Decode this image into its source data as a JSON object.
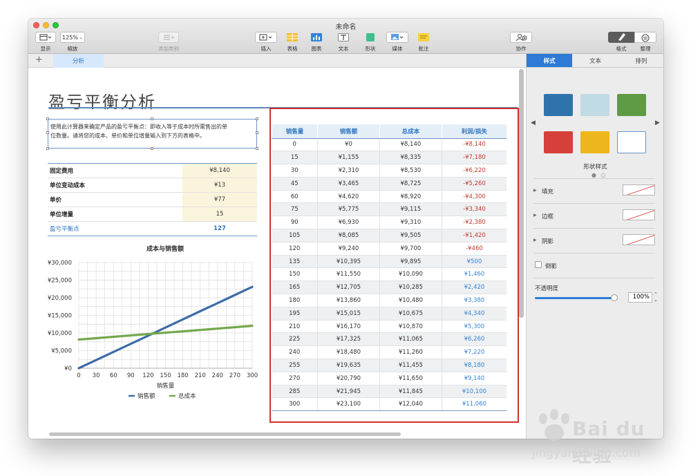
{
  "window": {
    "title": "未命名"
  },
  "toolbar": {
    "view_label": "显示",
    "zoom_value": "125%",
    "zoom_label": "缩放",
    "add_category_label": "添加类别",
    "insert_label": "插入",
    "table_label": "表格",
    "chart_label": "图表",
    "text_label": "文本",
    "shape_label": "形状",
    "media_label": "媒体",
    "comment_label": "批注",
    "collaborate_label": "协作",
    "format_label": "格式",
    "organize_label": "整理"
  },
  "sheet": {
    "add_symbol": "+",
    "tab_label": "分析"
  },
  "doc": {
    "title": "盈亏平衡分析",
    "intro_line1": "使用此计算器来确定产品的盈亏平衡点：即收入等于成本时所需售出的单",
    "intro_line2": "位数量。请将您的成本、单价和单位增量输入到下方的表格中。"
  },
  "inputs": [
    {
      "label": "固定费用",
      "value": "¥8,140"
    },
    {
      "label": "单位变动成本",
      "value": "¥13"
    },
    {
      "label": "单价",
      "value": "¥77"
    },
    {
      "label": "单位增量",
      "value": "15"
    },
    {
      "label": "盈亏平衡点",
      "value": "127"
    }
  ],
  "data_table": {
    "headers": [
      "销售量",
      "销售额",
      "总成本",
      "利润/损失"
    ],
    "rows": [
      [
        "0",
        "¥0",
        "¥8,140",
        "-¥8,140"
      ],
      [
        "15",
        "¥1,155",
        "¥8,335",
        "-¥7,180"
      ],
      [
        "30",
        "¥2,310",
        "¥8,530",
        "-¥6,220"
      ],
      [
        "45",
        "¥3,465",
        "¥8,725",
        "-¥5,260"
      ],
      [
        "60",
        "¥4,620",
        "¥8,920",
        "-¥4,300"
      ],
      [
        "75",
        "¥5,775",
        "¥9,115",
        "-¥3,340"
      ],
      [
        "90",
        "¥6,930",
        "¥9,310",
        "-¥2,380"
      ],
      [
        "105",
        "¥8,085",
        "¥9,505",
        "-¥1,420"
      ],
      [
        "120",
        "¥9,240",
        "¥9,700",
        "-¥460"
      ],
      [
        "135",
        "¥10,395",
        "¥9,895",
        "¥500"
      ],
      [
        "150",
        "¥11,550",
        "¥10,090",
        "¥1,460"
      ],
      [
        "165",
        "¥12,705",
        "¥10,285",
        "¥2,420"
      ],
      [
        "180",
        "¥13,860",
        "¥10,480",
        "¥3,380"
      ],
      [
        "195",
        "¥15,015",
        "¥10,675",
        "¥4,340"
      ],
      [
        "210",
        "¥16,170",
        "¥10,870",
        "¥5,300"
      ],
      [
        "225",
        "¥17,325",
        "¥11,065",
        "¥6,260"
      ],
      [
        "240",
        "¥18,480",
        "¥11,260",
        "¥7,220"
      ],
      [
        "255",
        "¥19,635",
        "¥11,455",
        "¥8,180"
      ],
      [
        "270",
        "¥20,790",
        "¥11,650",
        "¥9,140"
      ],
      [
        "285",
        "¥21,945",
        "¥11,845",
        "¥10,100"
      ],
      [
        "300",
        "¥23,100",
        "¥12,040",
        "¥11,060"
      ]
    ]
  },
  "chart_data": {
    "type": "line",
    "title": "成本与销售额",
    "xlabel": "销售量",
    "ylabel": "",
    "x": [
      0,
      30,
      60,
      90,
      120,
      150,
      180,
      210,
      240,
      270,
      300
    ],
    "x_tick_labels": [
      "0",
      "30",
      "60",
      "90",
      "120",
      "150",
      "180",
      "210",
      "240",
      "270",
      "300"
    ],
    "y_tick_labels": [
      "¥0",
      "¥5,000",
      "¥10,000",
      "¥15,000",
      "¥20,000",
      "¥25,000",
      "¥30,000"
    ],
    "xlim": [
      0,
      300
    ],
    "ylim": [
      0,
      30000
    ],
    "grid": true,
    "legend": "bottom",
    "series": [
      {
        "name": "销售额",
        "color": "#3d6ba6",
        "values": [
          0,
          2310,
          4620,
          6930,
          9240,
          11550,
          13860,
          16170,
          18480,
          20790,
          23100
        ]
      },
      {
        "name": "总成本",
        "color": "#74a84c",
        "values": [
          8140,
          8530,
          8920,
          9310,
          9700,
          10090,
          10480,
          10870,
          11260,
          11650,
          12040
        ]
      }
    ]
  },
  "inspector": {
    "tabs": [
      "样式",
      "文本",
      "排列"
    ],
    "swatch_colors": [
      "#2f73ac",
      "#c1dbe5",
      "#5f9a44",
      "#d6403a",
      "#edb61c",
      "#ffffff"
    ],
    "shape_style_label": "形状样式",
    "fill_label": "填充",
    "border_label": "边框",
    "shadow_label": "阴影",
    "reflection_label": "倒影",
    "opacity_label": "不透明度",
    "opacity_value": "100%",
    "opacity_level": 1.0
  },
  "watermark": {
    "text": "Bai du 经验",
    "url": "jingyan.baidu.com"
  }
}
